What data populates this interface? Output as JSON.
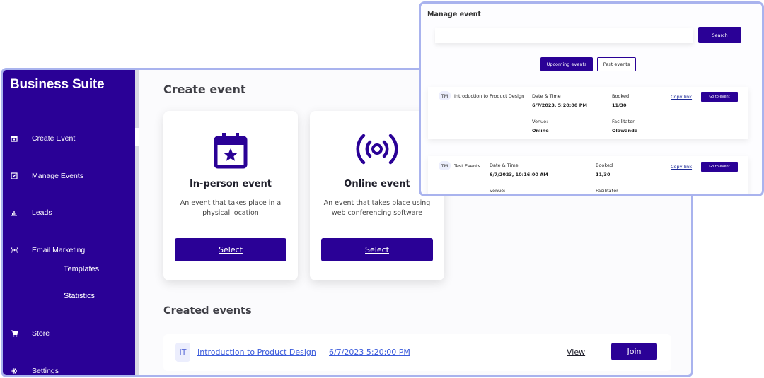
{
  "sidebar": {
    "brand": "Business Suite",
    "items": [
      {
        "label": "Create Event",
        "icon": "calendar-icon"
      },
      {
        "label": "Manage Events",
        "icon": "edit-icon"
      },
      {
        "label": "Leads",
        "icon": "bar-chart-icon"
      },
      {
        "label": "Email Marketing",
        "icon": "broadcast-icon"
      },
      {
        "label": "Store",
        "icon": "cart-icon"
      },
      {
        "label": "Settings",
        "icon": "gear-icon"
      }
    ],
    "sub_items": [
      {
        "label": "Templates"
      },
      {
        "label": "Statistics"
      }
    ]
  },
  "main": {
    "title": "Create event",
    "cards": [
      {
        "title": "In-person event",
        "description": "An event that takes place in a physical location",
        "button": "Select",
        "icon": "calendar-star-icon"
      },
      {
        "title": "Online event",
        "description": "An event that takes place using web conferencing software",
        "button": "Select",
        "icon": "broadcast-icon"
      }
    ],
    "created_title": "Created events",
    "created_events": [
      {
        "initials": "IT",
        "name": "Introduction to Product Design",
        "datetime": "6/7/2023 5:20:00 PM",
        "view_label": "View",
        "join_label": "Join"
      }
    ]
  },
  "manage": {
    "title": "Manage event",
    "search_placeholder": "",
    "search_button": "Search",
    "tabs": [
      {
        "label": "Upcoming events",
        "active": true
      },
      {
        "label": "Past events",
        "active": false
      }
    ],
    "labels": {
      "date_time": "Date & Time",
      "booked": "Booked",
      "venue": "Venue:",
      "facilitator": "Facilitator",
      "copy_link": "Copy link",
      "go_to_event": "Go to event"
    },
    "events": [
      {
        "initials": "TM",
        "name": "Introduction to Product Design",
        "date_time": "6/7/2023, 5:20:00 PM",
        "booked": "11/30",
        "venue": "Online",
        "facilitator": "Olawande"
      },
      {
        "initials": "TM",
        "name": "Test Events",
        "date_time": "6/7/2023, 10:16:00 AM",
        "booked": "11/30",
        "venue": "",
        "facilitator": ""
      }
    ]
  },
  "colors": {
    "primary": "#2a0196",
    "frame": "#a9b3ee",
    "link": "#3b5bdb"
  }
}
